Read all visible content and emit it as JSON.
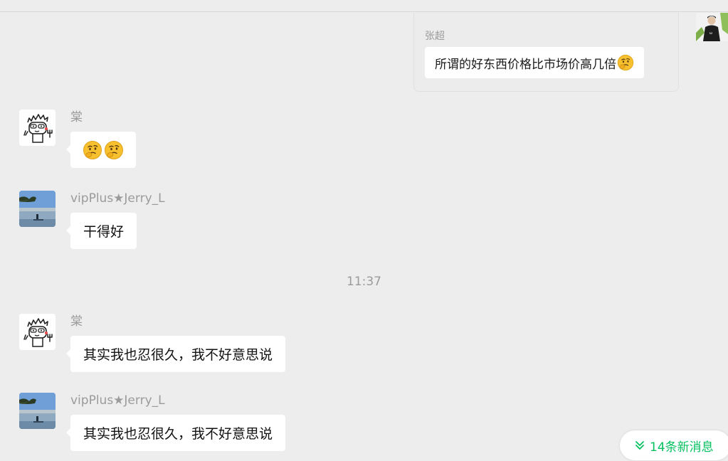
{
  "quoted": {
    "sender": "张超",
    "text": "所谓的好东西价格比市场价高几倍"
  },
  "messages": [
    {
      "sender": "棠",
      "text": ""
    },
    {
      "sender": "vipPlus★Jerry_L",
      "text": "干得好"
    },
    {
      "sender": "棠",
      "text": "其实我也忍很久，我不好意思说"
    },
    {
      "sender": "vipPlus★Jerry_L",
      "text": "其实我也忍很久，我不好意思说"
    }
  ],
  "time_divider": "11:37",
  "new_messages_button": "14条新消息",
  "icons": {
    "emoji": "thinking-face-emoji",
    "new_messages": "double-chevron-down-icon"
  },
  "colors": {
    "background": "#ededed",
    "bubble": "#ffffff",
    "accent": "#07c160"
  }
}
